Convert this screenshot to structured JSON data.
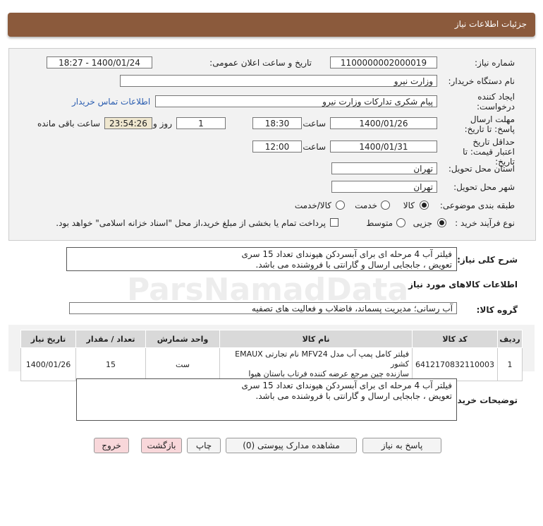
{
  "header": {
    "title": "جزئیات اطلاعات نیاز"
  },
  "form": {
    "need_number_label": "شماره نیاز:",
    "need_number": "1100000002000019",
    "announce_label": "تاریخ و ساعت اعلان عمومی:",
    "announce_value": "1400/01/24 - 18:27",
    "buyer_org_label": "نام دستگاه خریدار:",
    "buyer_org": "وزارت نیرو",
    "creator_label": "ایجاد کننده درخواست:",
    "creator": "پیام شکری تدارکات وزارت نیرو",
    "contact_link": "اطلاعات تماس خریدار",
    "reply_deadline_label": "مهلت ارسال پاسخ: تا تاریخ:",
    "reply_date": "1400/01/26",
    "time_label": "ساعت",
    "reply_time": "18:30",
    "days": "1",
    "days_label": "روز و",
    "remaining": "23:54:26",
    "remaining_label": "ساعت باقی مانده",
    "validity_label": "حداقل تاریخ اعتبار قیمت: تا تاریخ:",
    "validity_date": "1400/01/31",
    "validity_time": "12:00",
    "province_label": "استان محل تحویل:",
    "province": "تهران",
    "city_label": "شهر محل تحویل:",
    "city": "تهران",
    "category_label": "طبقه بندی موضوعی:",
    "cat_goods": "کالا",
    "cat_service": "خدمت",
    "cat_both": "کالا/خدمت",
    "process_label": "نوع فرآیند خرید :",
    "proc_partial": "جزیی",
    "proc_medium": "متوسط",
    "payment_note": "پرداخت تمام یا بخشی از مبلغ خرید،از محل \"اسناد خزانه اسلامی\" خواهد بود."
  },
  "summary": {
    "label": "شرح کلی نیاز:",
    "line1": "فیلتر آب 4 مرحله ای برای آبسردکن هیوندای تعداد 15 سری",
    "line2": "تعویض ، جابجایی ارسال و گارانتی با فروشنده می باشد."
  },
  "goods": {
    "section_title": "اطلاعات کالاهای مورد نیاز",
    "group_label": "گروه کالا:",
    "group_value": "آب رسانی؛ مدیریت پسماند، فاضلاب و فعالیت های تصفیه",
    "columns": [
      "ردیف",
      "کد کالا",
      "نام کالا",
      "واحد شمارش",
      "تعداد / مقدار",
      "تاریخ نیاز"
    ],
    "rows": [
      {
        "row": "1",
        "code": "6412170832110003",
        "name_line1": "فیلتر کامل پمپ آب مدل MFV24 نام تجارتی EMAUX کشور",
        "name_line2": "سازنده چین مرجع عرضه کننده فرتاب باستان هیوا",
        "unit": "ست",
        "qty": "15",
        "date": "1400/01/26"
      }
    ]
  },
  "buyer_notes": {
    "label": "توضیحات خریدار:",
    "line1": "فیلتر آب 4 مرحله ای برای آبسردکن هیوندای تعداد 15 سری",
    "line2": "تعویض ، جابجایی ارسال و گارانتی با فروشنده می باشد."
  },
  "buttons": {
    "reply": "پاسخ به نیاز",
    "docs": "مشاهده مدارک پیوستی (0)",
    "print": "چاپ",
    "back": "بازگشت",
    "exit": "خروج"
  },
  "watermark": "ParsNamadData"
}
